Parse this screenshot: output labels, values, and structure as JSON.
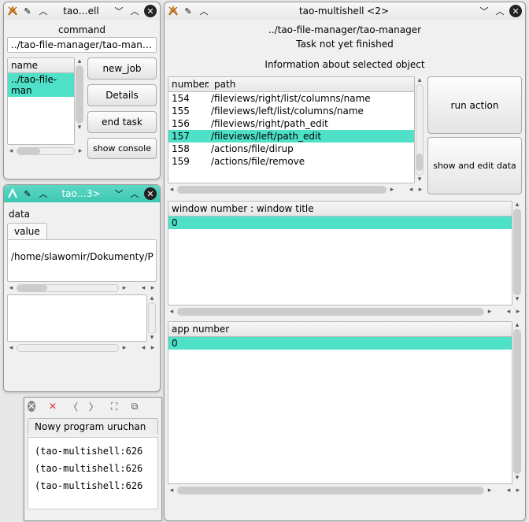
{
  "win1": {
    "title": "tao…ell",
    "command_label": "command",
    "command_value": "../tao-file-manager/tao-manager",
    "col_name": "name",
    "list_item0": "../tao-file-man",
    "buttons": {
      "new_job": "new_job",
      "details": "Details",
      "end_task": "end task",
      "show_console": "show console"
    }
  },
  "win2": {
    "title": "tao…3>",
    "data_label": "data",
    "tab_value": "value",
    "path_text": "/home/slawomir/Dokumenty/P"
  },
  "winterm": {
    "tab_label": "Nowy program uruchan",
    "lines": [
      "(tao-multishell:626",
      "(tao-multishell:626",
      "(tao-multishell:626"
    ]
  },
  "main": {
    "title": "tao-multishell <2>",
    "subtitle": "../tao-file-manager/tao-manager",
    "task_status": "Task not yet finished",
    "info_label": "Information about selected object",
    "col_number": "number",
    "col_sep": ":",
    "col_path": "path",
    "rows": [
      {
        "num": "154",
        "path": "/fileviews/right/list/columns/name"
      },
      {
        "num": "155",
        "path": "/fileviews/left/list/columns/name"
      },
      {
        "num": "156",
        "path": "/fileviews/right/path_edit"
      },
      {
        "num": "157",
        "path": "/fileviews/left/path_edit"
      },
      {
        "num": "158",
        "path": "/actions/file/dirup"
      },
      {
        "num": "159",
        "path": "/actions/file/remove"
      }
    ],
    "btn_run": "run action",
    "btn_show_edit": "show and edit data",
    "wn_header": "window number  :  window title",
    "wn_value": "0",
    "an_header": "app number",
    "an_value": "0"
  }
}
